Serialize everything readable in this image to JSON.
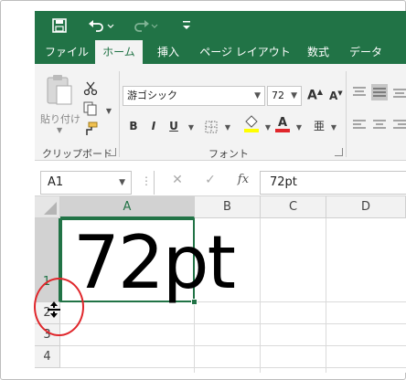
{
  "ribbon_tabs": [
    "ファイル",
    "ホーム",
    "挿入",
    "ページ レイアウト",
    "数式",
    "データ"
  ],
  "active_tab": "ホーム",
  "clipboard": {
    "paste_label": "貼り付け",
    "group_label": "クリップボード"
  },
  "font": {
    "name": "游ゴシック",
    "size": "72",
    "group_label": "フォント",
    "bold": "B",
    "italic": "I",
    "underline": "U",
    "grow": "A",
    "shrink": "A",
    "ruby": "亜",
    "highlight_color": "#ffff00",
    "font_color": "#e0262b"
  },
  "formula_bar": {
    "name_box": "A1",
    "fx": "fx",
    "content": "72pt"
  },
  "columns": [
    "A",
    "B",
    "C",
    "D"
  ],
  "rows": [
    "1",
    "2",
    "3",
    "4"
  ],
  "selected_cell": "A1",
  "cell_a1_text": "72pt",
  "accent_color": "#217346"
}
